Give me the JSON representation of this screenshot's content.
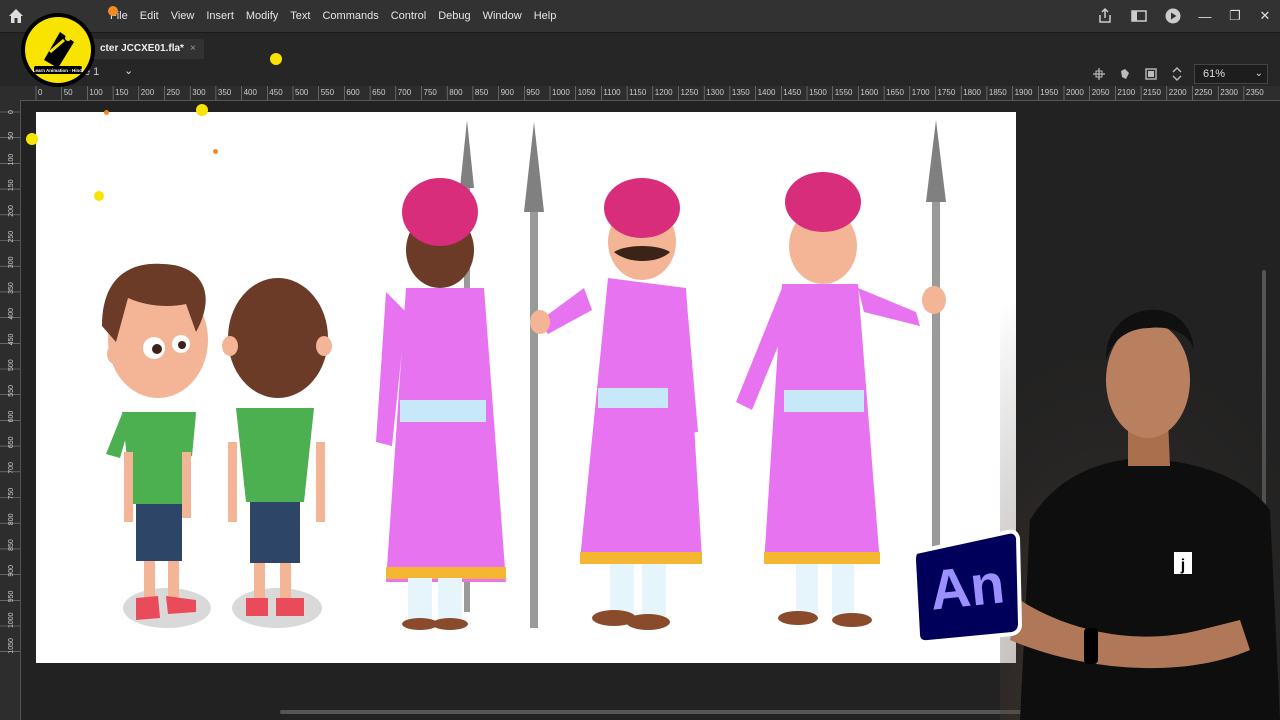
{
  "menubar": {
    "items": [
      "File",
      "Edit",
      "View",
      "Insert",
      "Modify",
      "Text",
      "Commands",
      "Control",
      "Debug",
      "Window",
      "Help"
    ]
  },
  "document_tab": {
    "title": "cter JCCXE01.fla*",
    "close": "×"
  },
  "scene": {
    "label": "e 1"
  },
  "zoom": {
    "value": "61%"
  },
  "ruler": {
    "top_ticks": [
      "0",
      "50",
      "100",
      "150",
      "200",
      "250",
      "300",
      "350",
      "400",
      "450",
      "500",
      "550",
      "600",
      "650",
      "700",
      "750",
      "800",
      "850",
      "900",
      "950",
      "1000",
      "1050",
      "1100",
      "1150",
      "1200",
      "1250",
      "1300",
      "1350",
      "1400",
      "1450",
      "1500",
      "1550",
      "1600",
      "1650",
      "1700",
      "1750",
      "1800",
      "1850",
      "1900",
      "1950",
      "2000",
      "2050",
      "2100",
      "2150",
      "2200",
      "2250",
      "2300",
      "2350"
    ],
    "left_ticks": [
      "0",
      "50",
      "100",
      "150",
      "200",
      "250",
      "300",
      "350",
      "400",
      "450",
      "500",
      "550",
      "600",
      "650",
      "700",
      "750",
      "800",
      "850",
      "900",
      "950",
      "1000",
      "1050"
    ]
  },
  "logo": {
    "caption": "Learn Animation - Hindi"
  },
  "badge": {
    "text": "An"
  },
  "colors": {
    "app_bg": "#1f1f1f",
    "stage": "#ffffff",
    "guard_robe": "#e873f0",
    "turban": "#d82d7a",
    "boy_shirt": "#4caf50",
    "boy_shorts": "#2d4566",
    "an_badge": "#00005b",
    "an_text": "#9c8fff",
    "logo_yellow": "#f8e400"
  }
}
